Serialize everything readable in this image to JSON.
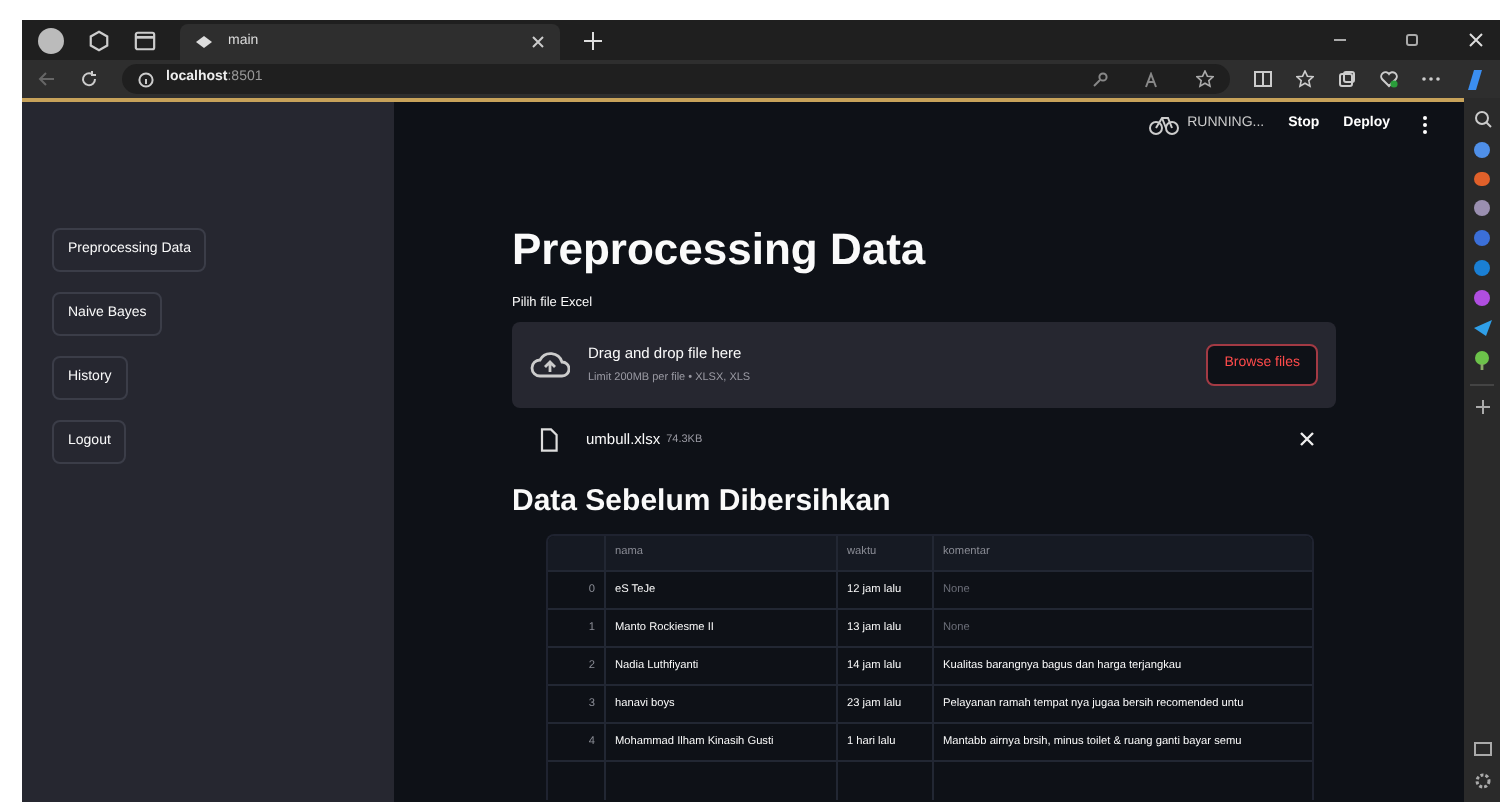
{
  "browser": {
    "tab": {
      "title": "main"
    },
    "address": {
      "host": "localhost",
      "port": ":8501"
    }
  },
  "header": {
    "status": "RUNNING...",
    "buttons": [
      "Stop",
      "Deploy"
    ]
  },
  "sidebar": {
    "items": [
      {
        "label": "Preprocessing Data"
      },
      {
        "label": "Naive Bayes"
      },
      {
        "label": "History"
      },
      {
        "label": "Logout"
      }
    ]
  },
  "main": {
    "title": "Preprocessing Data",
    "uploader": {
      "label": "Pilih file Excel",
      "prompt": "Drag and drop file here",
      "hint": "Limit 200MB per file • XLSX, XLS",
      "button": "Browse files"
    },
    "file": {
      "name": "umbull.xlsx",
      "size": "74.3KB"
    },
    "table_title": "Data Sebelum Dibersihkan",
    "table": {
      "columns": [
        "nama",
        "waktu",
        "komentar"
      ],
      "rows": [
        {
          "index": "0",
          "cells": [
            "eS TeJe",
            "12 jam lalu",
            "None"
          ],
          "null_comment": true
        },
        {
          "index": "1",
          "cells": [
            "Manto Rockiesme II",
            "13 jam lalu",
            "None"
          ],
          "null_comment": true
        },
        {
          "index": "2",
          "cells": [
            "Nadia Luthfiyanti",
            "14 jam lalu",
            "Kualitas barangnya bagus dan harga terjangkau"
          ],
          "null_comment": false
        },
        {
          "index": "3",
          "cells": [
            "hanavi boys",
            "23 jam lalu",
            "Pelayanan ramah tempat nya jugaa bersih recomended untu"
          ],
          "null_comment": false
        },
        {
          "index": "4",
          "cells": [
            "Mohammad Ilham Kinasih Gusti",
            "1 hari lalu",
            "Mantabb airnya brsih, minus toilet & ruang ganti bayar semu"
          ],
          "null_comment": false
        }
      ]
    }
  }
}
